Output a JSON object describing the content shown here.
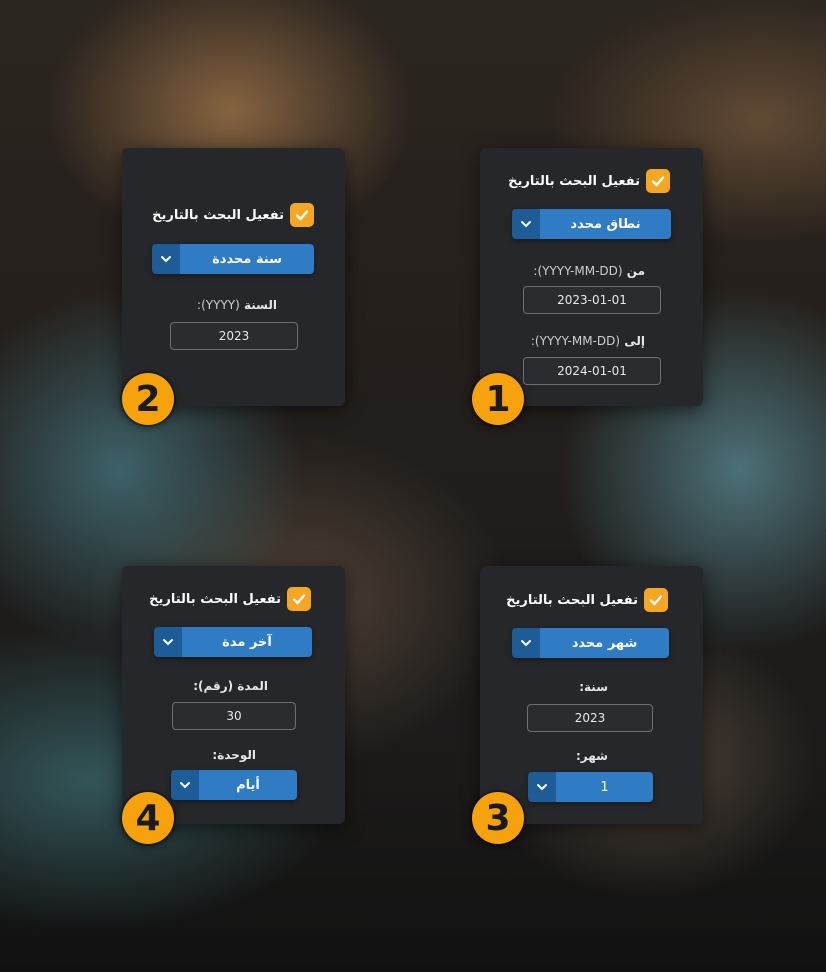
{
  "panels": {
    "range": {
      "badge": "1",
      "enable_label": "تفعيل البحث بالتاريخ",
      "checked": true,
      "mode_label": "نطاق محدد",
      "from_label": "من",
      "from_hint": "(YYYY-MM-DD):",
      "from_value": "2023-01-01",
      "to_label": "إلى",
      "to_hint": "(YYYY-MM-DD):",
      "to_value": "2024-01-01"
    },
    "year": {
      "badge": "2",
      "enable_label": "تفعيل البحث بالتاريخ",
      "checked": true,
      "mode_label": "سنة محددة",
      "year_label": "السنة",
      "year_hint": "(YYYY):",
      "year_value": "2023"
    },
    "month": {
      "badge": "3",
      "enable_label": "تفعيل البحث بالتاريخ",
      "checked": true,
      "mode_label": "شهر محدد",
      "year_label": "سنة:",
      "year_value": "2023",
      "month_label": "شهر:",
      "month_value": "1"
    },
    "last": {
      "badge": "4",
      "enable_label": "تفعيل البحث بالتاريخ",
      "checked": true,
      "mode_label": "آخر مدة",
      "duration_label": "المدة (رقم):",
      "duration_value": "30",
      "unit_label": "الوحدة:",
      "unit_value": "أيام"
    }
  },
  "colors": {
    "accent": "#f5a623",
    "select_blue": "#2f7bc4",
    "select_dark_blue": "#1d5c96",
    "card_bg": "#26272a"
  },
  "icons": {
    "checkbox": "check-icon",
    "select_arrow": "chevron-down-icon"
  }
}
